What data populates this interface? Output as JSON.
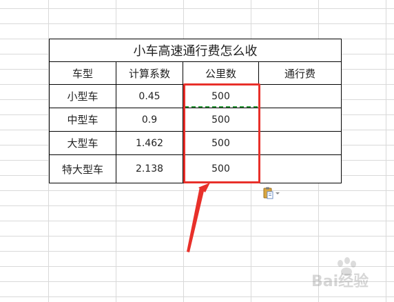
{
  "table": {
    "title": "小车高速通行费怎么收",
    "headers": [
      "车型",
      "计算系数",
      "公里数",
      "通行费"
    ],
    "rows": [
      {
        "type": "小型车",
        "coef": "0.45",
        "km": "500",
        "fee": ""
      },
      {
        "type": "中型车",
        "coef": "0.9",
        "km": "500",
        "fee": ""
      },
      {
        "type": "大型车",
        "coef": "1.462",
        "km": "500",
        "fee": ""
      },
      {
        "type": "特大型车",
        "coef": "2.138",
        "km": "500",
        "fee": ""
      }
    ]
  },
  "icons": {
    "paste_options": "clipboard-paste-icon",
    "annotation": "red-arrow-icon"
  },
  "watermark": {
    "text": "Bai经验"
  },
  "colors": {
    "highlight_box": "#e8302a",
    "copy_marquee": "#2f9a3d",
    "grid": "#d9d9d9",
    "border": "#000000"
  }
}
